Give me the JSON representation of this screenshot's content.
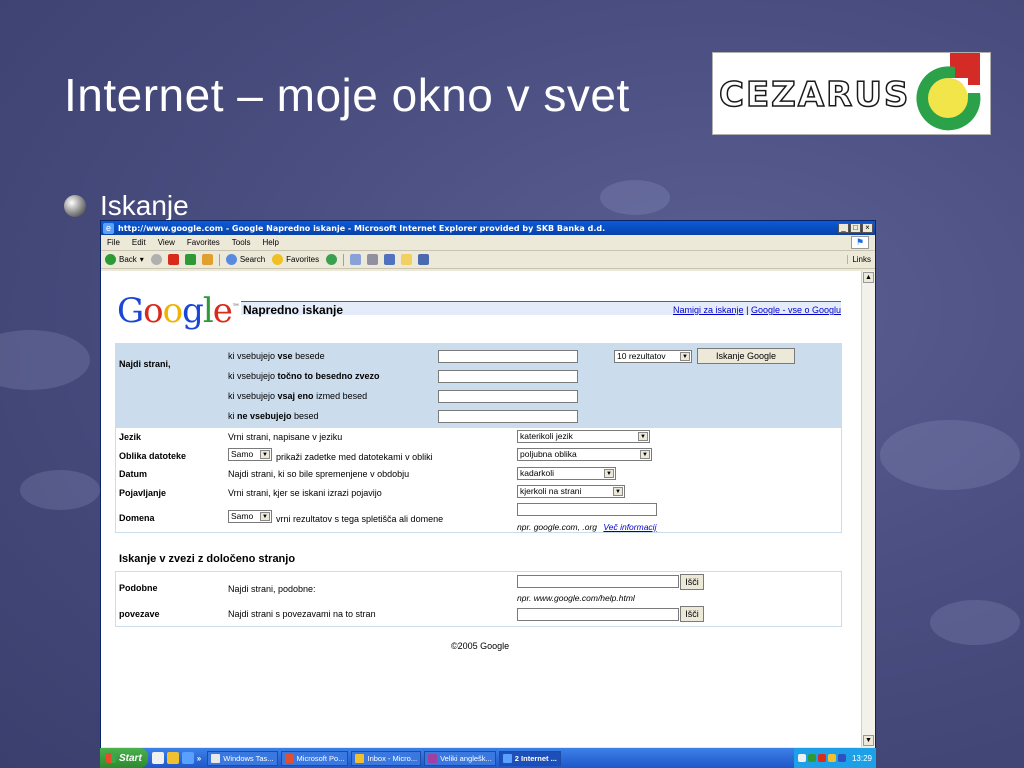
{
  "slide": {
    "title": "Internet – moje okno v svet",
    "bullet": "Iskanje",
    "logo_text": "CEZARUS"
  },
  "browser": {
    "window_title": "http://www.google.com - Google Napredno iskanje - Microsoft Internet Explorer provided by SKB Banka d.d.",
    "window_buttons": [
      "_",
      "□",
      "×"
    ],
    "menu": [
      "File",
      "Edit",
      "View",
      "Favorites",
      "Tools",
      "Help"
    ],
    "toolbar": {
      "back": "Back",
      "search": "Search",
      "favorites": "Favorites",
      "links": "Links"
    }
  },
  "page": {
    "logo": [
      "G",
      "o",
      "o",
      "g",
      "l",
      "e"
    ],
    "logo_tm": "™",
    "heading": "Napredno iskanje",
    "link_tips": "Namigi za iskanje",
    "link_separator": "|",
    "link_about": "Google - vse o Googlu",
    "find_label": "Najdi strani,",
    "find_rows": [
      {
        "pre": "ki vsebujejo ",
        "bold": "vse",
        "post": " besede"
      },
      {
        "pre": "ki vsebujejo ",
        "bold": "točno to besedno zvezo",
        "post": ""
      },
      {
        "pre": "ki vsebujejo ",
        "bold": "vsaj eno",
        "post": " izmed besed"
      },
      {
        "pre": "ki ",
        "bold": "ne vsebujejo",
        "post": " besed"
      }
    ],
    "results_select": "10 rezultatov",
    "search_button": "Iskanje Google",
    "options": [
      {
        "label": "Jezik",
        "desc": "Vrni strani, napisane v jeziku",
        "select": "katerikoli jezik"
      },
      {
        "label": "Oblika datoteke",
        "pre_select": "Samo",
        "desc": "prikaži zadetke med datotekami v obliki",
        "select": "poljubna oblika"
      },
      {
        "label": "Datum",
        "desc": "Najdi strani, ki so bile spremenjene v obdobju",
        "select": "kadarkoli"
      },
      {
        "label": "Pojavljanje",
        "desc": "Vrni strani, kjer se iskani izrazi pojavijo",
        "select": "kjerkoli na strani"
      },
      {
        "label": "Domena",
        "pre_select": "Samo",
        "desc": "vrni rezultatov s tega spletišča ali domene",
        "hint": "npr. google.com, .org",
        "hint_link": "Več informacij"
      }
    ],
    "section2_title": "Iskanje v zvezi z določeno stranjo",
    "similar": {
      "label": "Podobne",
      "desc": "Najdi strani, podobne:",
      "button": "Išči",
      "hint": "npr. www.google.com/help.html"
    },
    "links": {
      "label": "povezave",
      "desc": "Najdi strani s povezavami na to stran",
      "button": "Išči"
    },
    "copyright": "©2005 Google"
  },
  "taskbar": {
    "start": "Start",
    "chevron": "»",
    "tasks": [
      "Windows Tas...",
      "Microsoft Po...",
      "Inbox - Micro...",
      "Veliki anglešk...",
      "2 Internet ..."
    ],
    "clock": "13:29"
  },
  "colors": {
    "slide_bg": "#4a4e80",
    "google_panel": "#cbdced",
    "link": "#0000cc",
    "xp_blue": "#1f57c8"
  }
}
